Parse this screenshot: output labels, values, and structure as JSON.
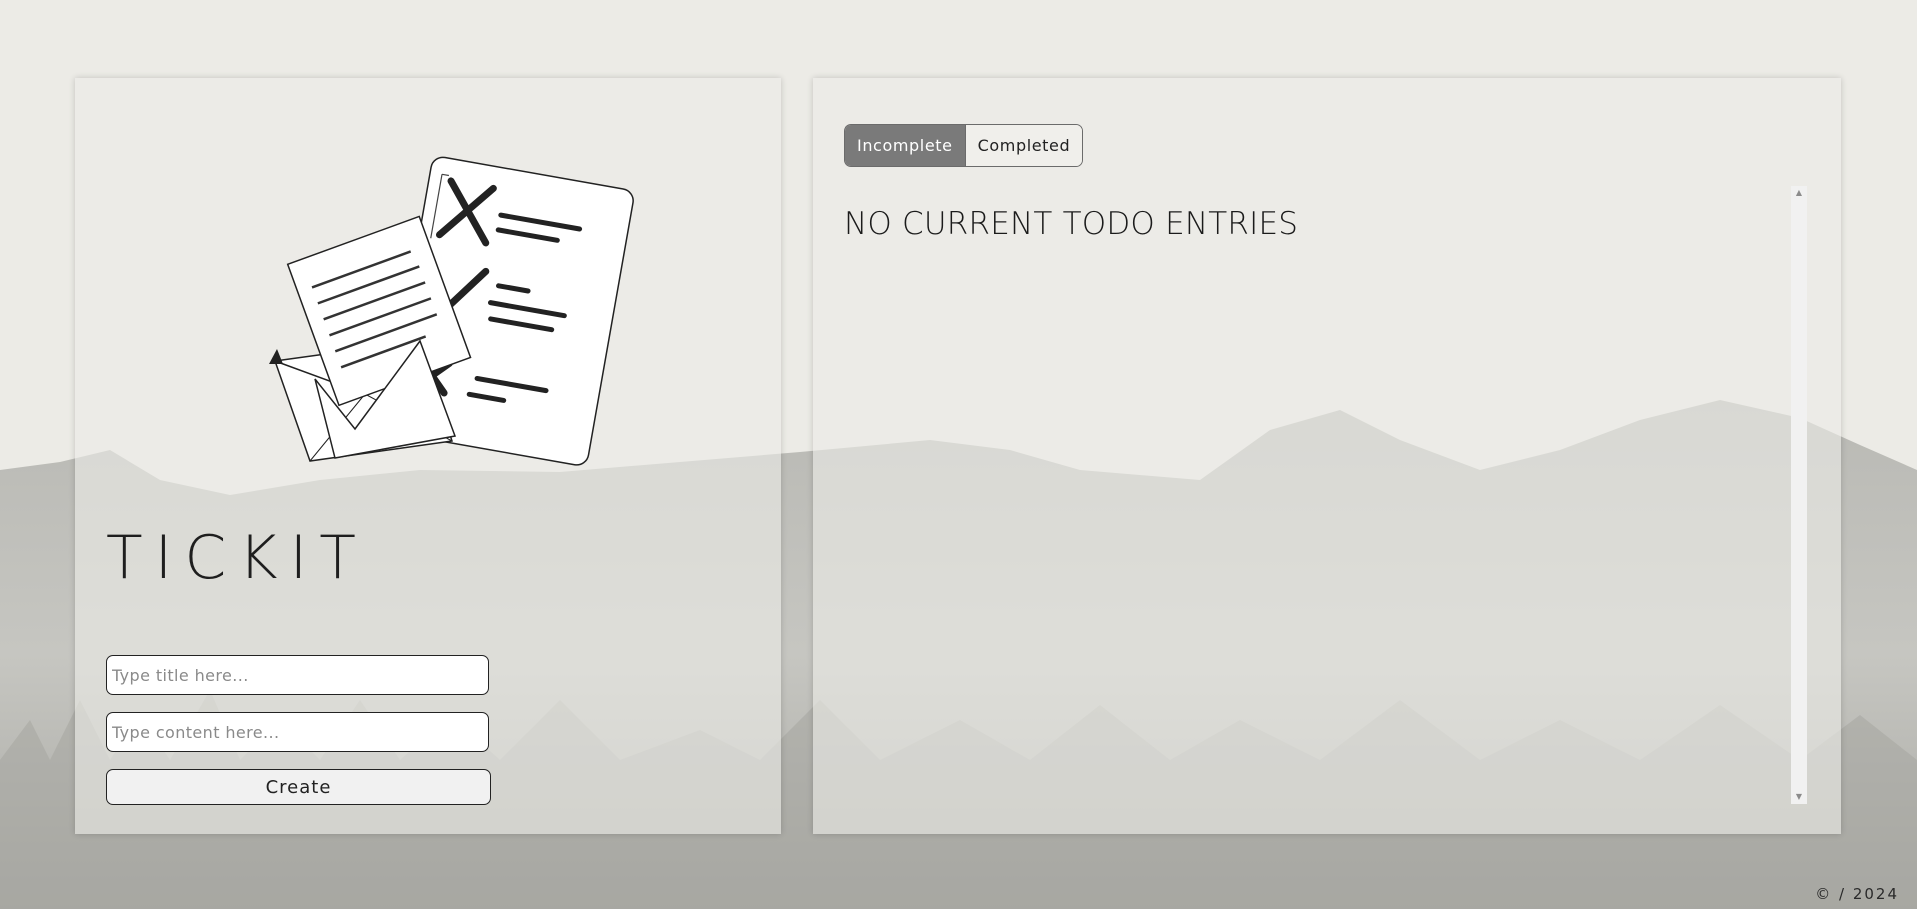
{
  "app": {
    "title": "TICKIT"
  },
  "form": {
    "title_placeholder": "Type title here...",
    "content_placeholder": "Type content here...",
    "create_label": "Create"
  },
  "tabs": [
    {
      "label": "Incomplete",
      "active": true
    },
    {
      "label": "Completed",
      "active": false
    }
  ],
  "list": {
    "empty_message": "NO CURRENT TODO ENTRIES"
  },
  "footer": {
    "text": "© / 2024"
  },
  "colors": {
    "background": "#ecebe6",
    "mountain": "#a3a39e",
    "active_tab": "#7a7a7a",
    "text": "#1e1e1e"
  },
  "icons": {
    "illustration": "envelope-and-checklist-illustration"
  }
}
